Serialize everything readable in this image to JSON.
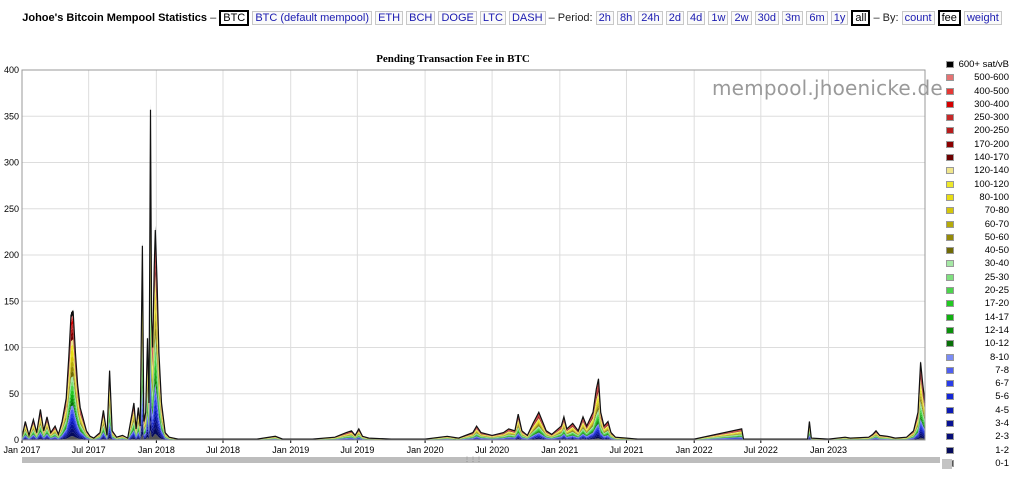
{
  "nav": {
    "site_title": "Johoe's Bitcoin Mempool Statistics",
    "sep1": "–",
    "coins": [
      {
        "label": "BTC",
        "active": true
      },
      {
        "label": "BTC (default mempool)",
        "active": false
      },
      {
        "label": "ETH",
        "active": false
      },
      {
        "label": "BCH",
        "active": false
      },
      {
        "label": "DOGE",
        "active": false
      },
      {
        "label": "LTC",
        "active": false
      },
      {
        "label": "DASH",
        "active": false
      }
    ],
    "period_label": "– Period:",
    "periods": [
      {
        "label": "2h",
        "active": false
      },
      {
        "label": "8h",
        "active": false
      },
      {
        "label": "24h",
        "active": false
      },
      {
        "label": "2d",
        "active": false
      },
      {
        "label": "4d",
        "active": false
      },
      {
        "label": "1w",
        "active": false
      },
      {
        "label": "2w",
        "active": false
      },
      {
        "label": "30d",
        "active": false
      },
      {
        "label": "3m",
        "active": false
      },
      {
        "label": "6m",
        "active": false
      },
      {
        "label": "1y",
        "active": false
      },
      {
        "label": "all",
        "active": true
      }
    ],
    "by_label": "– By:",
    "modes": [
      {
        "label": "count",
        "active": false
      },
      {
        "label": "fee",
        "active": true
      },
      {
        "label": "weight",
        "active": false
      }
    ]
  },
  "watermark": "mempool.jhoenicke.de",
  "colors": {
    "grid": "#dddddd",
    "axis": "#000000",
    "outline": "#111111"
  },
  "chart_data": {
    "type": "area",
    "title": "Pending Transaction Fee in BTC",
    "xlabel": "",
    "ylabel": "",
    "ylim": [
      0,
      400
    ],
    "yticks": [
      0,
      50,
      100,
      150,
      200,
      250,
      300,
      350,
      400
    ],
    "xlim": [
      "2017-01-01",
      "2023-09-20"
    ],
    "xticks": [
      {
        "date": "2017-01-01",
        "label": "Jan 2017"
      },
      {
        "date": "2017-07-01",
        "label": "Jul 2017"
      },
      {
        "date": "2018-01-01",
        "label": "Jan 2018"
      },
      {
        "date": "2018-07-01",
        "label": "Jul 2018"
      },
      {
        "date": "2019-01-01",
        "label": "Jan 2019"
      },
      {
        "date": "2019-07-01",
        "label": "Jul 2019"
      },
      {
        "date": "2020-01-01",
        "label": "Jan 2020"
      },
      {
        "date": "2020-07-01",
        "label": "Jul 2020"
      },
      {
        "date": "2021-01-01",
        "label": "Jan 2021"
      },
      {
        "date": "2021-07-01",
        "label": "Jul 2021"
      },
      {
        "date": "2022-01-01",
        "label": "Jan 2022"
      },
      {
        "date": "2022-07-01",
        "label": "Jul 2022"
      },
      {
        "date": "2023-01-01",
        "label": "Jan 2023"
      }
    ],
    "grid": true,
    "legend_position": "right",
    "total": [
      [
        "2017-01-01",
        3
      ],
      [
        "2017-01-10",
        20
      ],
      [
        "2017-01-20",
        5
      ],
      [
        "2017-02-01",
        22
      ],
      [
        "2017-02-10",
        8
      ],
      [
        "2017-02-20",
        33
      ],
      [
        "2017-03-01",
        10
      ],
      [
        "2017-03-10",
        25
      ],
      [
        "2017-03-20",
        8
      ],
      [
        "2017-04-01",
        15
      ],
      [
        "2017-04-10",
        6
      ],
      [
        "2017-04-20",
        20
      ],
      [
        "2017-05-01",
        45
      ],
      [
        "2017-05-08",
        90
      ],
      [
        "2017-05-14",
        135
      ],
      [
        "2017-05-20",
        138
      ],
      [
        "2017-05-26",
        95
      ],
      [
        "2017-06-01",
        60
      ],
      [
        "2017-06-08",
        35
      ],
      [
        "2017-06-15",
        25
      ],
      [
        "2017-06-25",
        10
      ],
      [
        "2017-07-05",
        4
      ],
      [
        "2017-07-15",
        2
      ],
      [
        "2017-08-01",
        8
      ],
      [
        "2017-08-10",
        32
      ],
      [
        "2017-08-20",
        5
      ],
      [
        "2017-08-27",
        75
      ],
      [
        "2017-09-03",
        10
      ],
      [
        "2017-09-15",
        3
      ],
      [
        "2017-10-01",
        5
      ],
      [
        "2017-10-15",
        2
      ],
      [
        "2017-11-01",
        40
      ],
      [
        "2017-11-07",
        12
      ],
      [
        "2017-11-13",
        35
      ],
      [
        "2017-11-18",
        15
      ],
      [
        "2017-11-24",
        210
      ],
      [
        "2017-11-28",
        20
      ],
      [
        "2017-12-03",
        30
      ],
      [
        "2017-12-08",
        110
      ],
      [
        "2017-12-12",
        40
      ],
      [
        "2017-12-16",
        357
      ],
      [
        "2017-12-19",
        130
      ],
      [
        "2017-12-22",
        100
      ],
      [
        "2017-12-26",
        185
      ],
      [
        "2017-12-29",
        227
      ],
      [
        "2018-01-03",
        170
      ],
      [
        "2018-01-08",
        95
      ],
      [
        "2018-01-15",
        40
      ],
      [
        "2018-01-25",
        8
      ],
      [
        "2018-02-05",
        3
      ],
      [
        "2018-03-01",
        1
      ],
      [
        "2018-06-01",
        1
      ],
      [
        "2018-10-01",
        1
      ],
      [
        "2018-11-20",
        4
      ],
      [
        "2018-12-10",
        1
      ],
      [
        "2019-03-01",
        1
      ],
      [
        "2019-05-01",
        3
      ],
      [
        "2019-06-01",
        8
      ],
      [
        "2019-06-15",
        10
      ],
      [
        "2019-06-25",
        5
      ],
      [
        "2019-07-05",
        12
      ],
      [
        "2019-07-15",
        4
      ],
      [
        "2019-08-01",
        2
      ],
      [
        "2019-10-01",
        1
      ],
      [
        "2020-01-01",
        1
      ],
      [
        "2020-03-01",
        4
      ],
      [
        "2020-04-01",
        2
      ],
      [
        "2020-05-10",
        8
      ],
      [
        "2020-05-20",
        15
      ],
      [
        "2020-06-01",
        8
      ],
      [
        "2020-07-01",
        5
      ],
      [
        "2020-08-01",
        8
      ],
      [
        "2020-08-15",
        12
      ],
      [
        "2020-09-01",
        10
      ],
      [
        "2020-09-10",
        28
      ],
      [
        "2020-09-20",
        10
      ],
      [
        "2020-10-05",
        5
      ],
      [
        "2020-10-20",
        18
      ],
      [
        "2020-11-05",
        30
      ],
      [
        "2020-11-15",
        20
      ],
      [
        "2020-11-25",
        10
      ],
      [
        "2020-12-10",
        6
      ],
      [
        "2021-01-05",
        15
      ],
      [
        "2021-01-12",
        25
      ],
      [
        "2021-01-20",
        12
      ],
      [
        "2021-02-05",
        18
      ],
      [
        "2021-02-20",
        10
      ],
      [
        "2021-03-05",
        25
      ],
      [
        "2021-03-15",
        15
      ],
      [
        "2021-04-01",
        30
      ],
      [
        "2021-04-10",
        55
      ],
      [
        "2021-04-16",
        66
      ],
      [
        "2021-04-22",
        30
      ],
      [
        "2021-05-01",
        15
      ],
      [
        "2021-05-12",
        20
      ],
      [
        "2021-05-20",
        8
      ],
      [
        "2021-06-01",
        3
      ],
      [
        "2021-07-01",
        2
      ],
      [
        "2021-08-01",
        1
      ],
      [
        "2021-11-01",
        1
      ],
      [
        "2022-01-01",
        1
      ],
      [
        "2022-05-10",
        12
      ],
      [
        "2022-05-15",
        1
      ],
      [
        "2022-08-01",
        1
      ],
      [
        "2022-11-05",
        1
      ],
      [
        "2022-11-10",
        20
      ],
      [
        "2022-11-15",
        2
      ],
      [
        "2023-01-01",
        1
      ],
      [
        "2023-02-15",
        3
      ],
      [
        "2023-03-01",
        2
      ],
      [
        "2023-04-20",
        3
      ],
      [
        "2023-05-01",
        6
      ],
      [
        "2023-05-10",
        10
      ],
      [
        "2023-05-20",
        5
      ],
      [
        "2023-06-10",
        4
      ],
      [
        "2023-07-01",
        2
      ],
      [
        "2023-08-01",
        3
      ],
      [
        "2023-08-20",
        10
      ],
      [
        "2023-09-01",
        30
      ],
      [
        "2023-09-08",
        84
      ],
      [
        "2023-09-14",
        60
      ],
      [
        "2023-09-20",
        40
      ]
    ],
    "series": [
      {
        "name": "600+ sat/vB",
        "color": "#000000",
        "share": 0.04
      },
      {
        "name": "500-600",
        "color": "#e57373",
        "share": 0.02
      },
      {
        "name": "400-500",
        "color": "#e53935",
        "share": 0.02
      },
      {
        "name": "300-400",
        "color": "#d50000",
        "share": 0.03
      },
      {
        "name": "250-300",
        "color": "#c62828",
        "share": 0.03
      },
      {
        "name": "200-250",
        "color": "#b71c1c",
        "share": 0.03
      },
      {
        "name": "170-200",
        "color": "#8b0000",
        "share": 0.03
      },
      {
        "name": "140-170",
        "color": "#6d0000",
        "share": 0.03
      },
      {
        "name": "120-140",
        "color": "#f0e68c",
        "share": 0.04
      },
      {
        "name": "100-120",
        "color": "#eee82a",
        "share": 0.04
      },
      {
        "name": "80-100",
        "color": "#e8dd12",
        "share": 0.05
      },
      {
        "name": "70-80",
        "color": "#d4c60c",
        "share": 0.04
      },
      {
        "name": "60-70",
        "color": "#b5aa0a",
        "share": 0.04
      },
      {
        "name": "50-60",
        "color": "#958a08",
        "share": 0.04
      },
      {
        "name": "40-50",
        "color": "#6f6a06",
        "share": 0.04
      },
      {
        "name": "30-40",
        "color": "#a5e8a5",
        "share": 0.04
      },
      {
        "name": "25-30",
        "color": "#7fe07f",
        "share": 0.03
      },
      {
        "name": "20-25",
        "color": "#4cd44c",
        "share": 0.04
      },
      {
        "name": "17-20",
        "color": "#22c922",
        "share": 0.03
      },
      {
        "name": "14-17",
        "color": "#10b010",
        "share": 0.03
      },
      {
        "name": "12-14",
        "color": "#0b900b",
        "share": 0.03
      },
      {
        "name": "10-12",
        "color": "#087008",
        "share": 0.03
      },
      {
        "name": "8-10",
        "color": "#7b8cf5",
        "share": 0.03
      },
      {
        "name": "7-8",
        "color": "#4f5ff0",
        "share": 0.03
      },
      {
        "name": "6-7",
        "color": "#2a3de8",
        "share": 0.03
      },
      {
        "name": "5-6",
        "color": "#1426d6",
        "share": 0.03
      },
      {
        "name": "4-5",
        "color": "#0c1ab5",
        "share": 0.03
      },
      {
        "name": "3-4",
        "color": "#081294",
        "share": 0.03
      },
      {
        "name": "2-3",
        "color": "#060d78",
        "share": 0.03
      },
      {
        "name": "1-2",
        "color": "#040a5c",
        "share": 0.03
      },
      {
        "name": "0-1",
        "color": "#555555",
        "share": 0.03
      }
    ]
  }
}
